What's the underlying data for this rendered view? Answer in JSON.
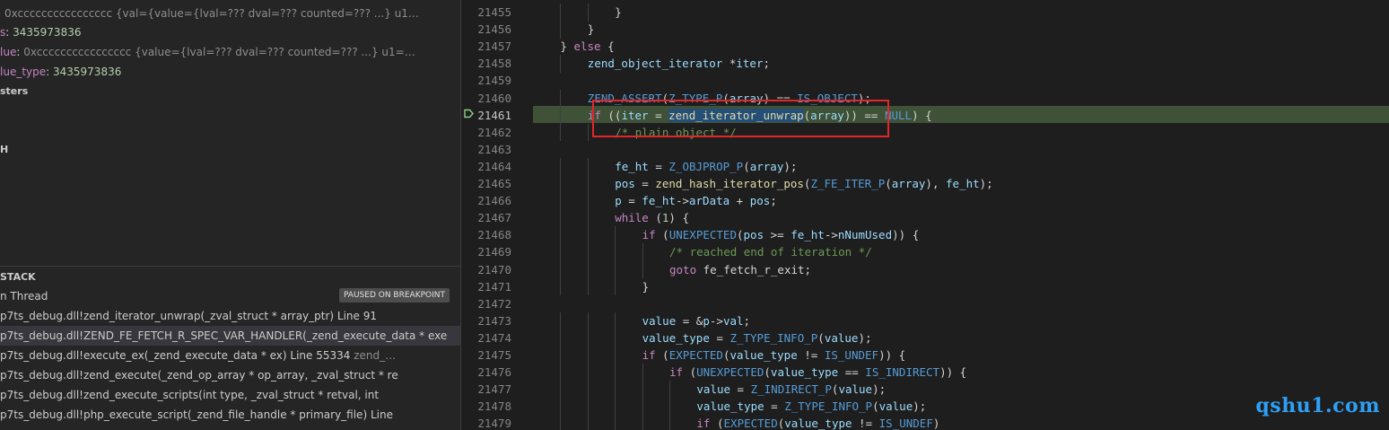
{
  "variables": [
    {
      "name": "",
      "value": "0xcccccccccccccccc {val={value={lval=??? dval=??? counted=??? ...} u1…",
      "kind": "ptr"
    },
    {
      "name": "s",
      "value": "3435973836",
      "kind": "num"
    },
    {
      "name": "lue",
      "value": "0xcccccccccccccccc {value={lval=??? dval=??? counted=??? ...} u1=…",
      "kind": "ptr"
    },
    {
      "name": "lue_type",
      "value": "3435973836",
      "kind": "num"
    }
  ],
  "sections": {
    "registers": "sters",
    "watch": "H",
    "call_stack": "STACK"
  },
  "thread": {
    "label": "n Thread",
    "status": "PAUSED ON BREAKPOINT"
  },
  "call_stack": [
    {
      "text": "p7ts_debug.dll!zend_iterator_unwrap(_zval_struct * array_ptr) Line 91",
      "extra": ""
    },
    {
      "text": "p7ts_debug.dll!ZEND_FE_FETCH_R_SPEC_VAR_HANDLER(_zend_execute_data * exe",
      "extra": ""
    },
    {
      "text": "p7ts_debug.dll!execute_ex(_zend_execute_data * ex) Line 55334",
      "extra": "zend_…"
    },
    {
      "text": "p7ts_debug.dll!zend_execute(_zend_op_array * op_array, _zval_struct * re",
      "extra": ""
    },
    {
      "text": "p7ts_debug.dll!zend_execute_scripts(int type, _zval_struct * retval, int",
      "extra": ""
    },
    {
      "text": "p7ts_debug.dll!php_execute_script(_zend_file_handle * primary_file) Line",
      "extra": ""
    }
  ],
  "editor": {
    "current_line": "21461",
    "lines": [
      {
        "n": "21455",
        "indent": 3,
        "tokens": [
          [
            "}",
            ""
          ]
        ]
      },
      {
        "n": "21456",
        "indent": 2,
        "tokens": [
          [
            "}",
            ""
          ]
        ]
      },
      {
        "n": "21457",
        "indent": 1,
        "tokens": [
          [
            "} ",
            ""
          ],
          [
            "else",
            "kw"
          ],
          [
            " {",
            ""
          ]
        ]
      },
      {
        "n": "21458",
        "indent": 2,
        "tokens": [
          [
            "zend_object_iterator",
            "id"
          ],
          [
            " *",
            ""
          ],
          [
            "iter",
            "id"
          ],
          [
            ";",
            ""
          ]
        ]
      },
      {
        "n": "21459",
        "indent": 0,
        "tokens": []
      },
      {
        "n": "21460",
        "indent": 2,
        "tokens": [
          [
            "ZEND_ASSERT",
            "mc"
          ],
          [
            "(",
            ""
          ],
          [
            "Z_TYPE_P",
            "mc"
          ],
          [
            "(",
            ""
          ],
          [
            "array",
            "id"
          ],
          [
            ") == ",
            ""
          ],
          [
            "IS_OBJECT",
            "mc"
          ],
          [
            ");",
            ""
          ]
        ]
      },
      {
        "n": "21461",
        "indent": 2,
        "tokens": [
          [
            "if",
            "kw"
          ],
          [
            " ((",
            ""
          ],
          [
            "iter",
            "id"
          ],
          [
            " = ",
            ""
          ],
          [
            "zend_iterator_unwrap",
            "fn sel"
          ],
          [
            "(",
            ""
          ],
          [
            "array",
            "id"
          ],
          [
            ")) == ",
            ""
          ],
          [
            "NULL",
            "mc"
          ],
          [
            ") {",
            ""
          ]
        ]
      },
      {
        "n": "21462",
        "indent": 3,
        "tokens": [
          [
            "/* plain object */",
            "cm"
          ]
        ]
      },
      {
        "n": "21463",
        "indent": 0,
        "tokens": []
      },
      {
        "n": "21464",
        "indent": 3,
        "tokens": [
          [
            "fe_ht",
            "id"
          ],
          [
            " = ",
            ""
          ],
          [
            "Z_OBJPROP_P",
            "mc"
          ],
          [
            "(",
            ""
          ],
          [
            "array",
            "id"
          ],
          [
            ");",
            ""
          ]
        ]
      },
      {
        "n": "21465",
        "indent": 3,
        "tokens": [
          [
            "pos",
            "id"
          ],
          [
            " = ",
            ""
          ],
          [
            "zend_hash_iterator_pos",
            "fn"
          ],
          [
            "(",
            ""
          ],
          [
            "Z_FE_ITER_P",
            "mc"
          ],
          [
            "(",
            ""
          ],
          [
            "array",
            "id"
          ],
          [
            "), ",
            ""
          ],
          [
            "fe_ht",
            "id"
          ],
          [
            ");",
            ""
          ]
        ]
      },
      {
        "n": "21466",
        "indent": 3,
        "tokens": [
          [
            "p",
            "id"
          ],
          [
            " = ",
            ""
          ],
          [
            "fe_ht",
            "id"
          ],
          [
            "->",
            ""
          ],
          [
            "arData",
            "id"
          ],
          [
            " + ",
            ""
          ],
          [
            "pos",
            "id"
          ],
          [
            ";",
            ""
          ]
        ]
      },
      {
        "n": "21467",
        "indent": 3,
        "tokens": [
          [
            "while",
            "kw"
          ],
          [
            " (",
            ""
          ],
          [
            "1",
            "nm"
          ],
          [
            ") {",
            ""
          ]
        ]
      },
      {
        "n": "21468",
        "indent": 4,
        "tokens": [
          [
            "if",
            "kw"
          ],
          [
            " (",
            ""
          ],
          [
            "UNEXPECTED",
            "mc"
          ],
          [
            "(",
            ""
          ],
          [
            "pos",
            "id"
          ],
          [
            " >= ",
            ""
          ],
          [
            "fe_ht",
            "id"
          ],
          [
            "->",
            ""
          ],
          [
            "nNumUsed",
            "id"
          ],
          [
            ")) {",
            ""
          ]
        ]
      },
      {
        "n": "21469",
        "indent": 5,
        "tokens": [
          [
            "/* reached end of iteration */",
            "cm"
          ]
        ]
      },
      {
        "n": "21470",
        "indent": 5,
        "tokens": [
          [
            "goto",
            "kw"
          ],
          [
            " fe_fetch_r_exit;",
            ""
          ]
        ]
      },
      {
        "n": "21471",
        "indent": 4,
        "tokens": [
          [
            "}",
            ""
          ]
        ]
      },
      {
        "n": "21472",
        "indent": 0,
        "tokens": []
      },
      {
        "n": "21473",
        "indent": 4,
        "tokens": [
          [
            "value",
            "id"
          ],
          [
            " = &",
            ""
          ],
          [
            "p",
            "id"
          ],
          [
            "->",
            ""
          ],
          [
            "val",
            "id"
          ],
          [
            ";",
            ""
          ]
        ]
      },
      {
        "n": "21474",
        "indent": 4,
        "tokens": [
          [
            "value_type",
            "id"
          ],
          [
            " = ",
            ""
          ],
          [
            "Z_TYPE_INFO_P",
            "mc"
          ],
          [
            "(",
            ""
          ],
          [
            "value",
            "id"
          ],
          [
            ");",
            ""
          ]
        ]
      },
      {
        "n": "21475",
        "indent": 4,
        "tokens": [
          [
            "if",
            "kw"
          ],
          [
            " (",
            ""
          ],
          [
            "EXPECTED",
            "mc"
          ],
          [
            "(",
            ""
          ],
          [
            "value_type",
            "id"
          ],
          [
            " != ",
            ""
          ],
          [
            "IS_UNDEF",
            "mc"
          ],
          [
            ")) {",
            ""
          ]
        ]
      },
      {
        "n": "21476",
        "indent": 5,
        "tokens": [
          [
            "if",
            "kw"
          ],
          [
            " (",
            ""
          ],
          [
            "UNEXPECTED",
            "mc"
          ],
          [
            "(",
            ""
          ],
          [
            "value_type",
            "id"
          ],
          [
            " == ",
            ""
          ],
          [
            "IS_INDIRECT",
            "mc"
          ],
          [
            ")) {",
            ""
          ]
        ]
      },
      {
        "n": "21477",
        "indent": 6,
        "tokens": [
          [
            "value",
            "id"
          ],
          [
            " = ",
            ""
          ],
          [
            "Z_INDIRECT_P",
            "mc"
          ],
          [
            "(",
            ""
          ],
          [
            "value",
            "id"
          ],
          [
            ");",
            ""
          ]
        ]
      },
      {
        "n": "21478",
        "indent": 6,
        "tokens": [
          [
            "value_type",
            "id"
          ],
          [
            " = ",
            ""
          ],
          [
            "Z_TYPE_INFO_P",
            "mc"
          ],
          [
            "(",
            ""
          ],
          [
            "value",
            "id"
          ],
          [
            ");",
            ""
          ]
        ]
      },
      {
        "n": "21479",
        "indent": 6,
        "tokens": [
          [
            "if",
            "kw"
          ],
          [
            " (",
            ""
          ],
          [
            "EXPECTED",
            "mc"
          ],
          [
            "(",
            ""
          ],
          [
            "value_type",
            "id"
          ],
          [
            " != ",
            ""
          ],
          [
            "IS_UNDEF",
            "mc"
          ],
          [
            ")",
            ""
          ]
        ]
      }
    ]
  },
  "watermark": "qshu1.com",
  "colors": {
    "current_line_bg": "#3f5136",
    "highlight_box": "#e3262a",
    "selection": "#264f78"
  }
}
